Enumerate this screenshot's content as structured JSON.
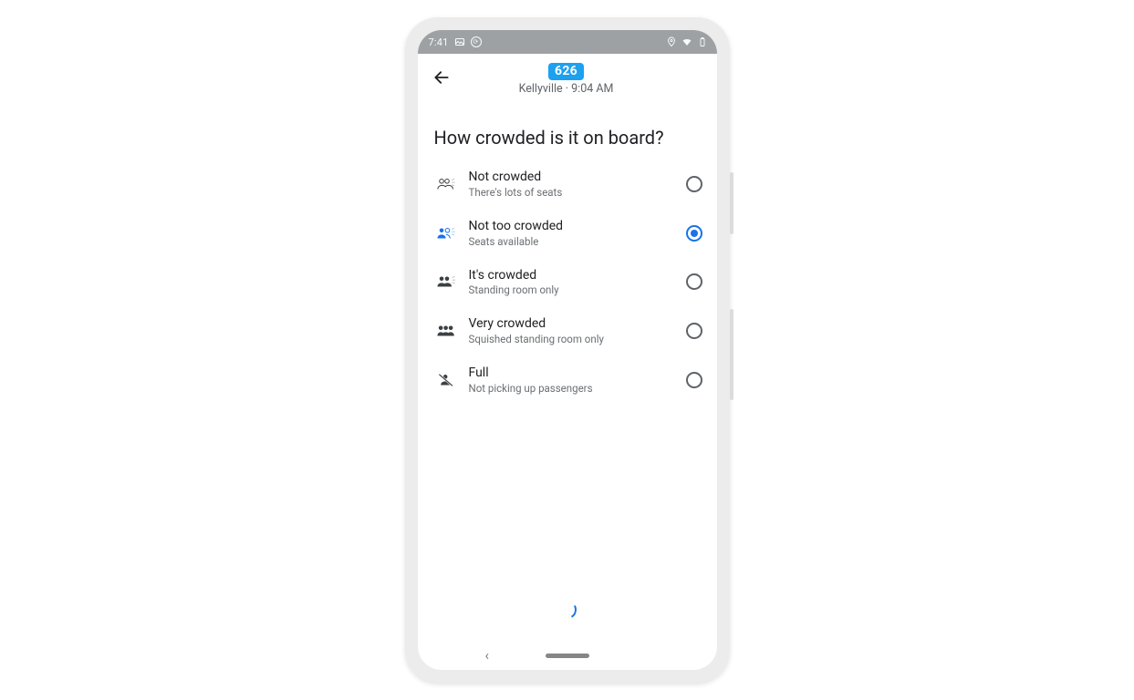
{
  "status_bar": {
    "time": "7:41"
  },
  "header": {
    "route_number": "626",
    "location": "Kellyville",
    "time": "9:04 AM"
  },
  "question": "How crowded is it on board?",
  "options": [
    {
      "id": "not-crowded",
      "title": "Not crowded",
      "subtitle": "There's lots of seats",
      "selected": false
    },
    {
      "id": "not-too-crowded",
      "title": "Not too crowded",
      "subtitle": "Seats available",
      "selected": true
    },
    {
      "id": "its-crowded",
      "title": "It's crowded",
      "subtitle": "Standing room only",
      "selected": false
    },
    {
      "id": "very-crowded",
      "title": "Very crowded",
      "subtitle": "Squished standing room only",
      "selected": false
    },
    {
      "id": "full",
      "title": "Full",
      "subtitle": "Not picking up passengers",
      "selected": false
    }
  ]
}
